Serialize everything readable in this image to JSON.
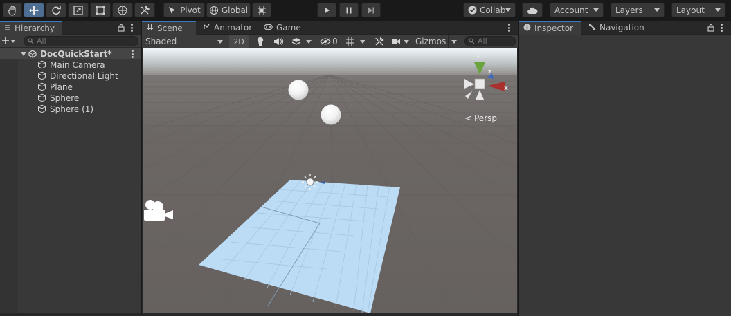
{
  "toolbar": {
    "tools": [
      "hand-tool",
      "move-tool",
      "rotate-tool",
      "scale-tool",
      "rect-tool",
      "transform-tool",
      "custom-tool"
    ],
    "active_tool": "move-tool",
    "pivot_label": "Pivot",
    "global_label": "Global",
    "collab_label": "Collab",
    "account_label": "Account",
    "layers_label": "Layers",
    "layout_label": "Layout"
  },
  "hierarchy": {
    "tab_label": "Hierarchy",
    "search_placeholder": "All",
    "scene_name": "DocQuickStart*",
    "items": [
      {
        "label": "Main Camera"
      },
      {
        "label": "Directional Light"
      },
      {
        "label": "Plane"
      },
      {
        "label": "Sphere"
      },
      {
        "label": "Sphere (1)"
      }
    ]
  },
  "scene_view": {
    "tabs": [
      {
        "label": "Scene"
      },
      {
        "label": "Animator"
      },
      {
        "label": "Game"
      }
    ],
    "shading_mode": "Shaded",
    "mode_2d_label": "2D",
    "hidden_count": "0",
    "gizmos_label": "Gizmos",
    "search_placeholder": "All",
    "projection_label": "Persp",
    "axis_labels": {
      "y": "y",
      "z": "z",
      "x": "x"
    }
  },
  "inspector": {
    "tabs": [
      {
        "label": "Inspector"
      },
      {
        "label": "Navigation"
      }
    ]
  },
  "colors": {
    "editor_bg": "#191919",
    "panel_bg": "#383838",
    "selection_blue": "#3a79bb",
    "sky_top": "#e3eef5",
    "ground": "#6a6563",
    "plane": "#b9dcf6"
  }
}
